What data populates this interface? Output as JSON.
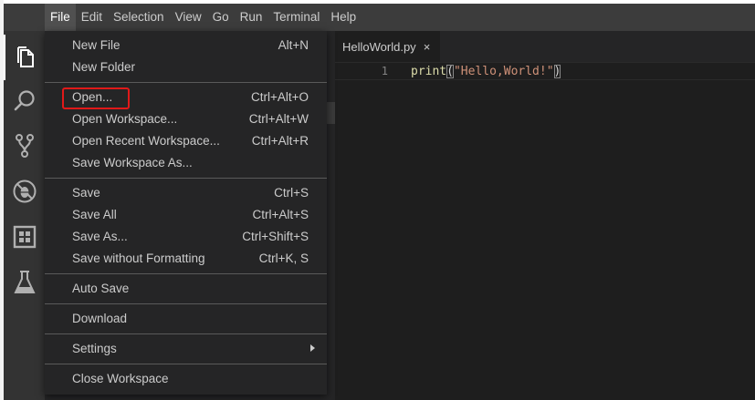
{
  "menubar": {
    "items": [
      "File",
      "Edit",
      "Selection",
      "View",
      "Go",
      "Run",
      "Terminal",
      "Help"
    ],
    "active": "File"
  },
  "activity_bar": {
    "icons": [
      "files-icon",
      "search-icon",
      "source-control-icon",
      "debug-icon",
      "extensions-icon",
      "test-flask-icon"
    ],
    "active": "files-icon"
  },
  "editor": {
    "tab": {
      "label": "HelloWorld.py",
      "close": "×"
    },
    "lines": [
      {
        "number": "1",
        "fn": "print",
        "open": "(",
        "str": "\"Hello,World!\"",
        "close": ")"
      }
    ]
  },
  "file_menu": {
    "groups": [
      [
        {
          "label": "New File",
          "shortcut": "Alt+N"
        },
        {
          "label": "New Folder",
          "shortcut": ""
        }
      ],
      [
        {
          "label": "Open...",
          "shortcut": "Ctrl+Alt+O",
          "highlighted": true
        },
        {
          "label": "Open Workspace...",
          "shortcut": "Ctrl+Alt+W"
        },
        {
          "label": "Open Recent Workspace...",
          "shortcut": "Ctrl+Alt+R"
        },
        {
          "label": "Save Workspace As...",
          "shortcut": ""
        }
      ],
      [
        {
          "label": "Save",
          "shortcut": "Ctrl+S"
        },
        {
          "label": "Save All",
          "shortcut": "Ctrl+Alt+S"
        },
        {
          "label": "Save As...",
          "shortcut": "Ctrl+Shift+S"
        },
        {
          "label": "Save without Formatting",
          "shortcut": "Ctrl+K, S"
        }
      ],
      [
        {
          "label": "Auto Save",
          "shortcut": ""
        }
      ],
      [
        {
          "label": "Download",
          "shortcut": ""
        }
      ],
      [
        {
          "label": "Settings",
          "shortcut": "",
          "submenu": true
        }
      ],
      [
        {
          "label": "Close Workspace",
          "shortcut": ""
        }
      ]
    ]
  },
  "colors": {
    "annotation": "#e11919",
    "menubar_bg": "#3c3c3c",
    "menu_bg": "#252526",
    "string": "#ce9178",
    "function": "#dcdcaa"
  }
}
